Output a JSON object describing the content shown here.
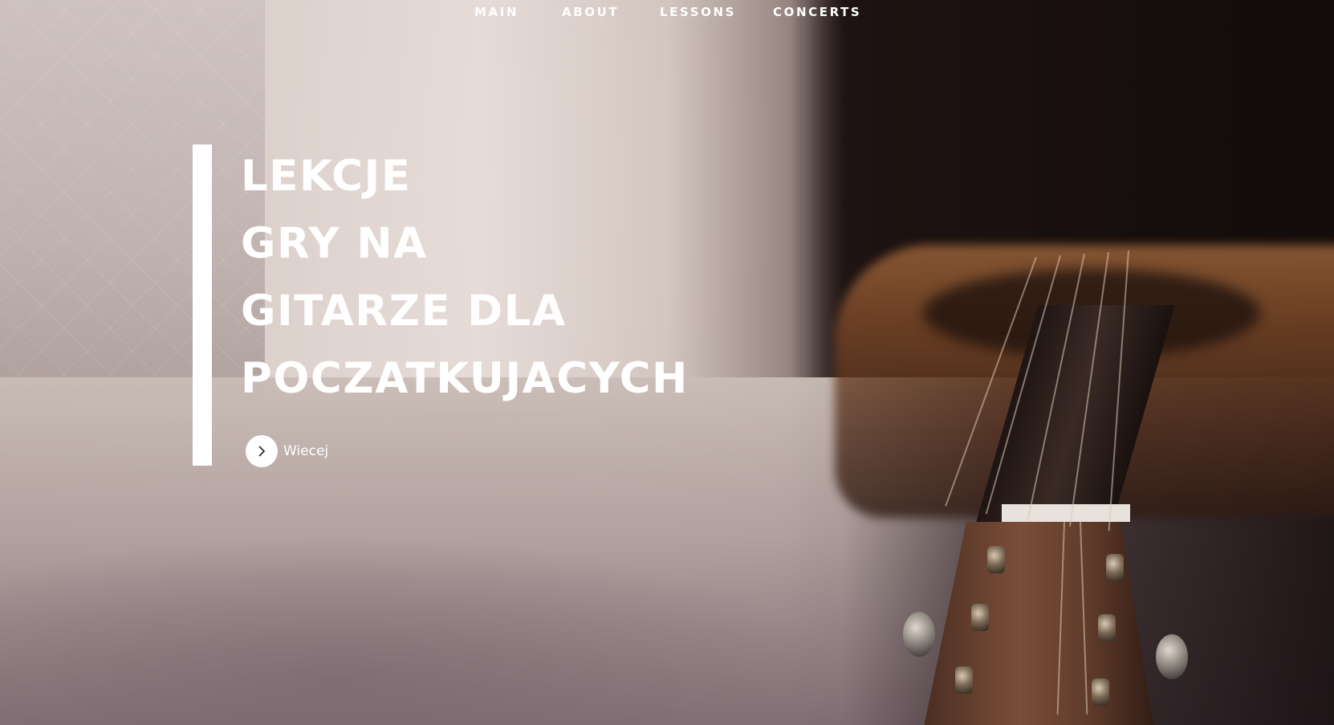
{
  "nav": {
    "items": [
      {
        "label": "MAIN"
      },
      {
        "label": "ABOUT"
      },
      {
        "label": "LESSONS"
      },
      {
        "label": "CONCERTS"
      }
    ]
  },
  "hero": {
    "headline_lines": [
      "LEKCJE",
      "GRY NA",
      "GITARZE DLA",
      "POCZATKUJACYCH"
    ],
    "cta_label": "Wiecej"
  },
  "colors": {
    "text": "#ffffff",
    "accent_bar": "#ffffff"
  },
  "icons": {
    "cta": "chevron-right-icon"
  }
}
